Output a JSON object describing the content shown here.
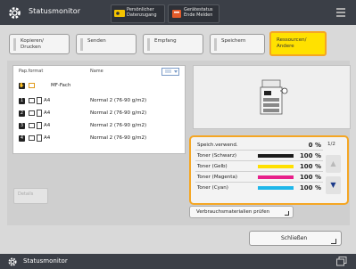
{
  "header": {
    "title": "Statusmonitor",
    "btn1_label": "Persönlicher Datenzugang",
    "btn2_label": "Gerätestatus Ende Melden"
  },
  "tabs": [
    {
      "label": "Kopieren/\nDrucken"
    },
    {
      "label": "Senden"
    },
    {
      "label": "Empfang"
    },
    {
      "label": "Speichern"
    },
    {
      "label": "Ressourcen/\nAndere"
    }
  ],
  "list": {
    "col_format": "Pap.format",
    "col_name": "Name",
    "rows": [
      {
        "num": "",
        "format": "MF-Fach",
        "name": ""
      },
      {
        "num": "1",
        "format": "A4",
        "name": "Normal 2 (76-90 g/m2)"
      },
      {
        "num": "2",
        "format": "A4",
        "name": "Normal 2 (76-90 g/m2)"
      },
      {
        "num": "3",
        "format": "A4",
        "name": "Normal 2 (76-90 g/m2)"
      },
      {
        "num": "4",
        "format": "A4",
        "name": "Normal 2 (76-90 g/m2)"
      }
    ],
    "details_label": "Details"
  },
  "status": {
    "rows": [
      {
        "label": "Speich.verwend.",
        "value": "0 %",
        "color": ""
      },
      {
        "label": "Toner (Schwarz)",
        "value": "100 %",
        "color": "#1a1a1a"
      },
      {
        "label": "Toner (Gelb)",
        "value": "100 %",
        "color": "#ffe000"
      },
      {
        "label": "Toner (Magenta)",
        "value": "100 %",
        "color": "#e8208a"
      },
      {
        "label": "Toner (Cyan)",
        "value": "100 %",
        "color": "#1fb7ea"
      }
    ],
    "page": "1/2"
  },
  "consumables_label": "Verbrauchsmaterialien prüfen",
  "close_label": "Schließen",
  "footer_title": "Statusmonitor"
}
